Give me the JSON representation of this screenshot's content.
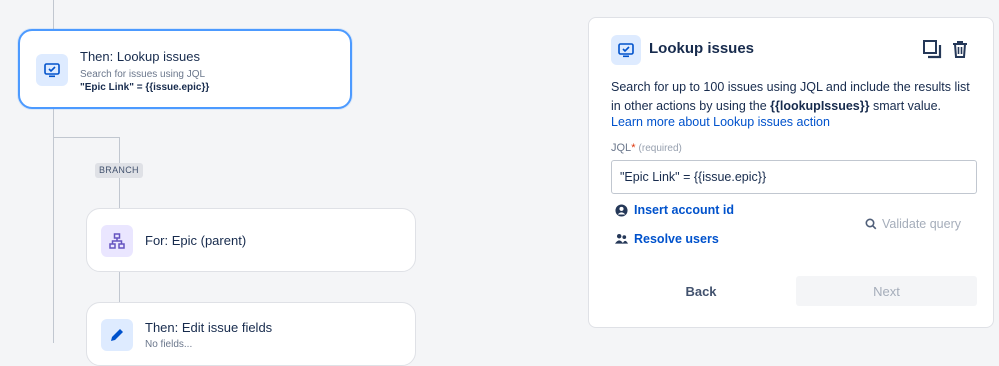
{
  "flow": {
    "lookup_node": {
      "title": "Then: Lookup issues",
      "subtitle": "Search for issues using JQL",
      "jql": "\"Epic Link\" = {{issue.epic}}"
    },
    "branch_label": "BRANCH",
    "for_node": {
      "title": "For: Epic (parent)"
    },
    "edit_node": {
      "title": "Then: Edit issue fields",
      "subtitle": "No fields..."
    }
  },
  "panel": {
    "title": "Lookup issues",
    "description_pre": "Search for up to 100 issues using JQL and include the results list in other actions by using the ",
    "description_bold": "{{lookupIssues}}",
    "description_post": " smart value.",
    "learn_more": "Learn more about Lookup issues action",
    "jql_label": "JQL",
    "jql_required_mark": "*",
    "jql_required_text": "(required)",
    "jql_value": "\"Epic Link\" = {{issue.epic}}",
    "insert_account": "Insert account id",
    "resolve_users": "Resolve users",
    "validate_query": "Validate query",
    "back_label": "Back",
    "next_label": "Next"
  },
  "icons": {
    "lookup": "monitor-check-icon",
    "branch": "hierarchy-icon",
    "edit": "pencil-icon",
    "duplicate": "duplicate-icon",
    "delete": "trash-icon",
    "user": "user-circle-icon",
    "users": "users-icon",
    "search": "search-icon"
  },
  "colors": {
    "accent": "#0052cc",
    "selected_border": "#4c9aff",
    "icon_bg_blue": "#deebff",
    "icon_bg_purple": "#eae6ff"
  }
}
